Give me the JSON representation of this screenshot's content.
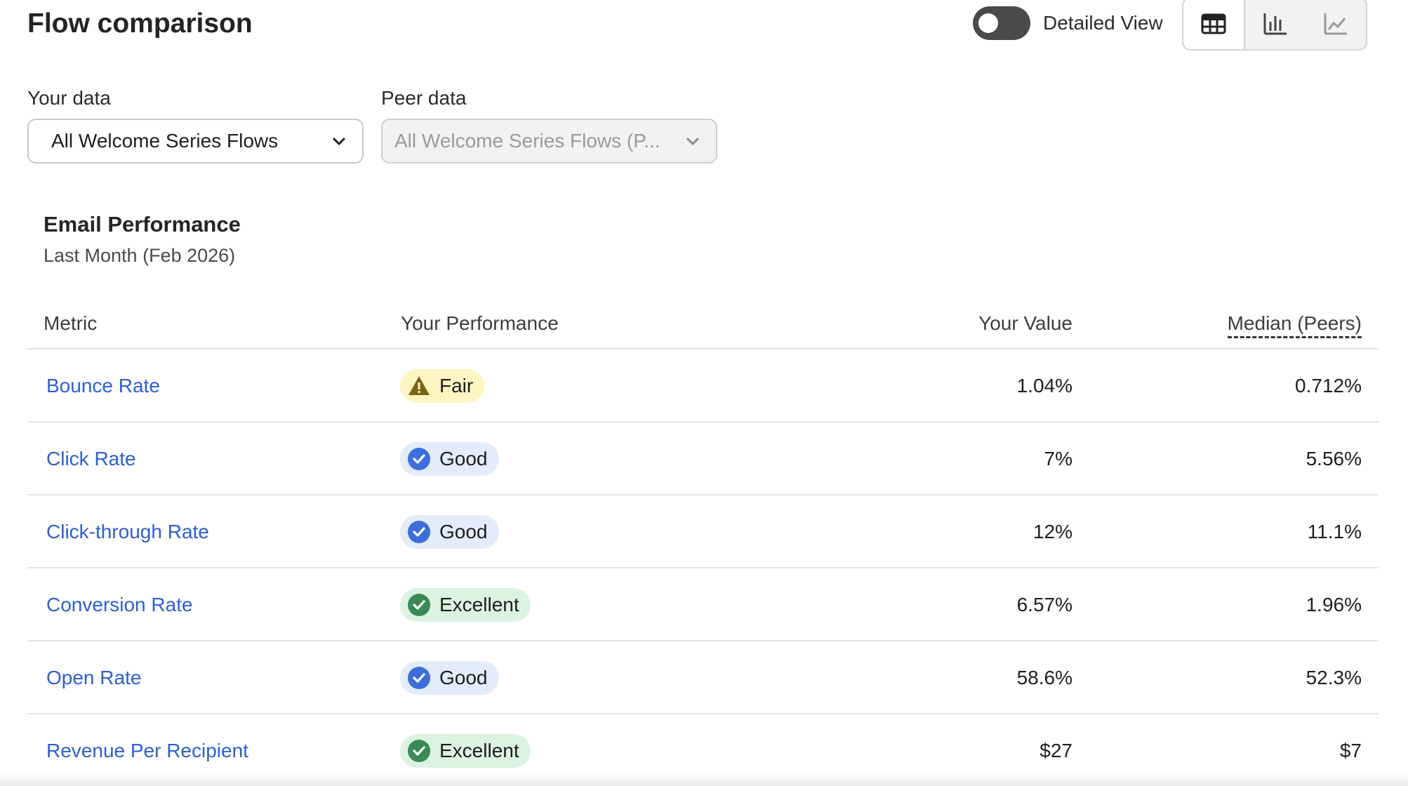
{
  "page_title": "Flow comparison",
  "toggle": {
    "label": "Detailed View",
    "checked": false
  },
  "view_switcher": {
    "options": [
      {
        "icon": "table-icon",
        "active": true
      },
      {
        "icon": "bar-chart-icon",
        "active": false
      },
      {
        "icon": "line-chart-icon",
        "active": false
      }
    ]
  },
  "filters": {
    "your_data": {
      "label": "Your data",
      "value": "All Welcome Series Flows"
    },
    "peer_data": {
      "label": "Peer data",
      "value": "All Welcome Series Flows (P...",
      "disabled": true
    }
  },
  "card": {
    "title": "Email Performance",
    "subtitle": "Last Month (Feb 2026)"
  },
  "table": {
    "headers": {
      "metric": "Metric",
      "performance": "Your Performance",
      "value": "Your Value",
      "median": "Median (Peers)"
    },
    "rows": [
      {
        "metric": "Bounce Rate",
        "status": "Fair",
        "status_icon": "warning-icon",
        "value": "1.04%",
        "median": "0.712%"
      },
      {
        "metric": "Click Rate",
        "status": "Good",
        "status_icon": "check-circle-icon",
        "value": "7%",
        "median": "5.56%"
      },
      {
        "metric": "Click-through Rate",
        "status": "Good",
        "status_icon": "check-circle-icon",
        "value": "12%",
        "median": "11.1%"
      },
      {
        "metric": "Conversion Rate",
        "status": "Excellent",
        "status_icon": "check-circle-icon",
        "value": "6.57%",
        "median": "1.96%"
      },
      {
        "metric": "Open Rate",
        "status": "Good",
        "status_icon": "check-circle-icon",
        "value": "58.6%",
        "median": "52.3%"
      },
      {
        "metric": "Revenue Per Recipient",
        "status": "Excellent",
        "status_icon": "check-circle-icon",
        "value": "$27",
        "median": "$7"
      }
    ]
  },
  "colors": {
    "link": "#2c5fd6",
    "fair_bg": "#fdf5c2",
    "fair_icon": "#7a6418",
    "good_bg": "#e3ecfb",
    "good_icon": "#3a6fdc",
    "excellent_bg": "#ddf3e2",
    "excellent_icon": "#3b8a55"
  }
}
